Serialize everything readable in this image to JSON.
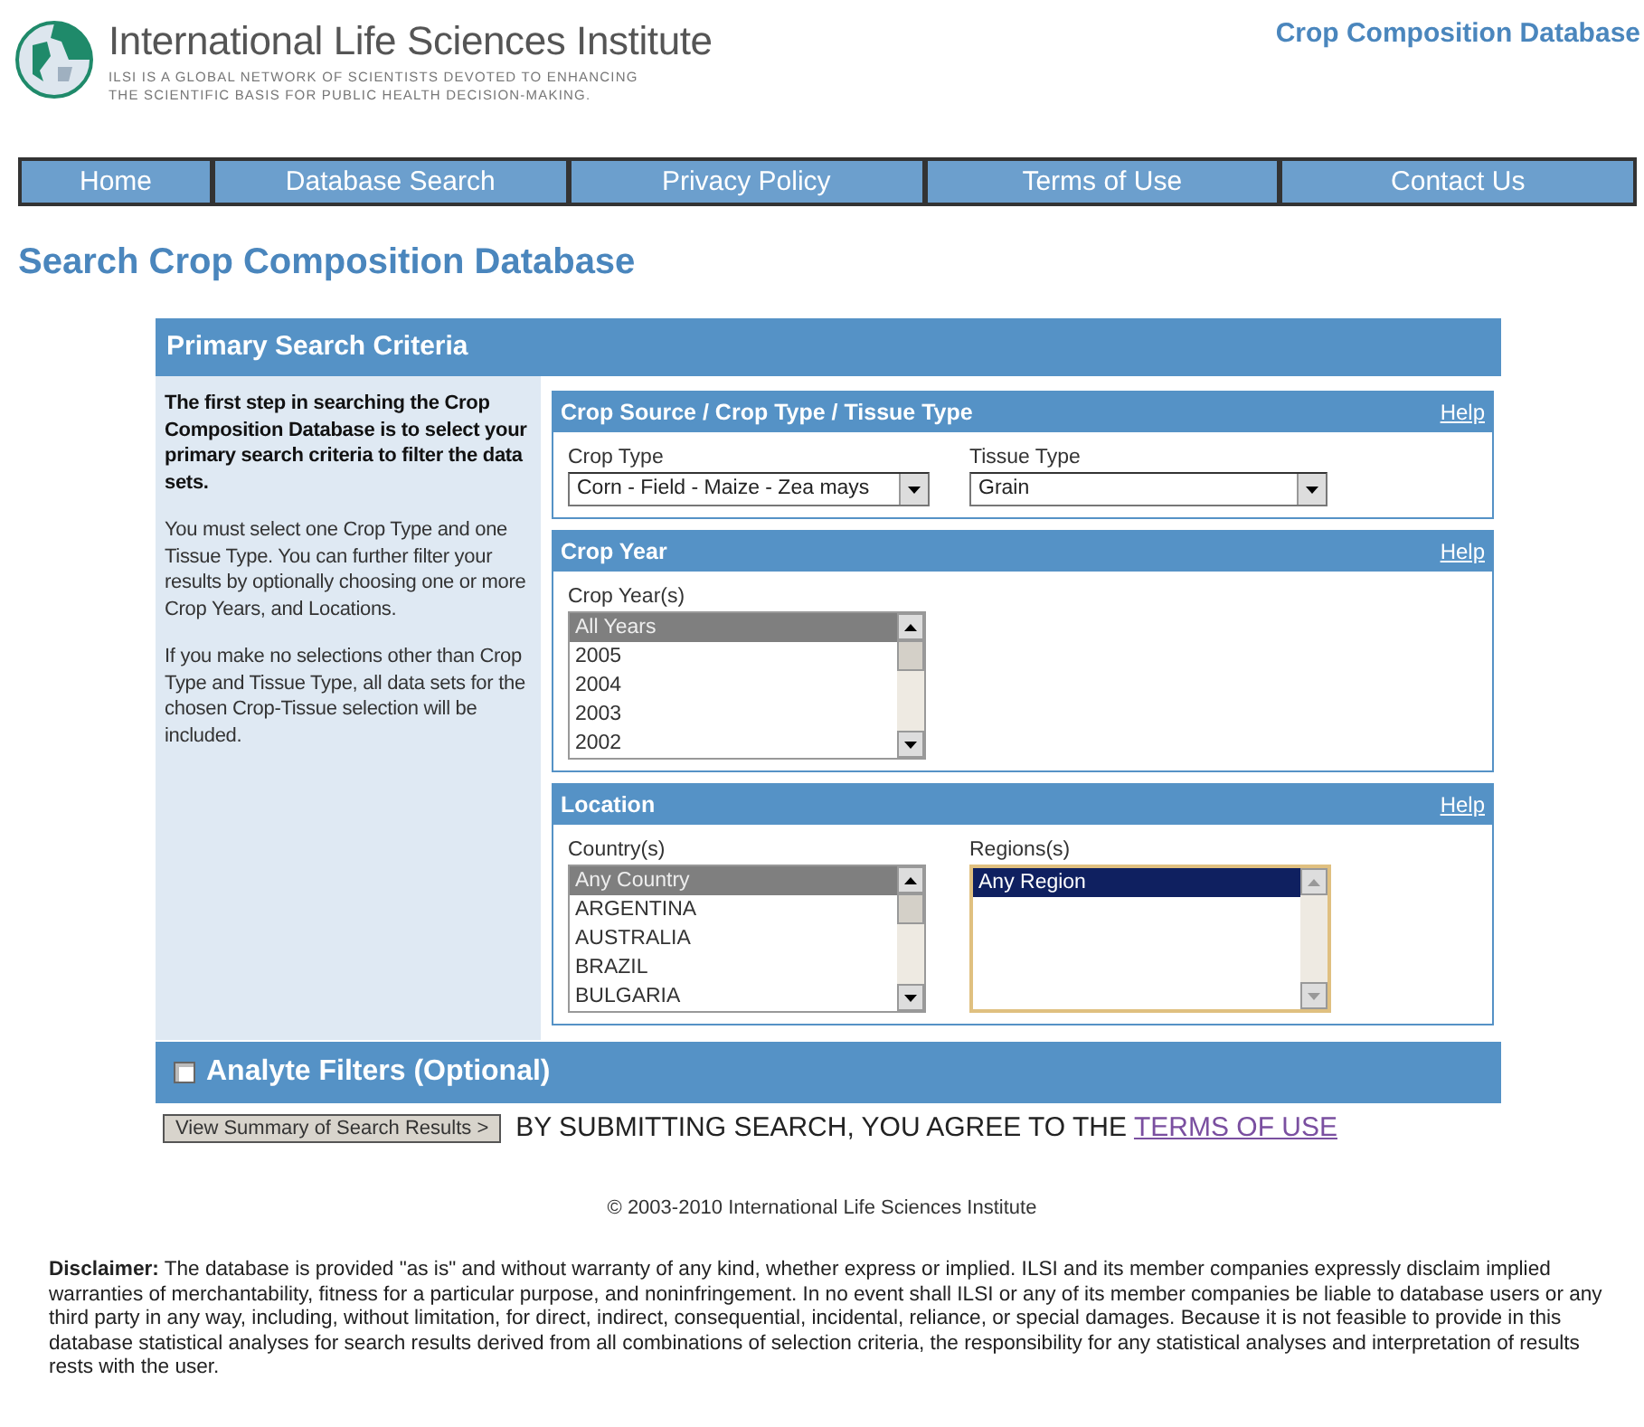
{
  "header": {
    "org_name": "International Life Sciences Institute",
    "tagline_lines": [
      "ILSI IS A GLOBAL NETWORK OF SCIENTISTS DEVOTED TO ENHANCING",
      "THE SCIENTIFIC BASIS FOR PUBLIC HEALTH DECISION-MAKING."
    ],
    "site_title": "Crop Composition Database"
  },
  "nav": [
    "Home",
    "Database Search",
    "Privacy Policy",
    "Terms of Use",
    "Contact Us"
  ],
  "page_title": "Search Crop Composition Database",
  "panel": {
    "title": "Primary Search Criteria",
    "intro": [
      {
        "kind": "lead",
        "text": "The first step in searching the Crop Composition Database is to select your primary search criteria to filter the data sets."
      },
      {
        "kind": "body",
        "text": "You must select one Crop Type and one Tissue Type. You can further filter your results by optionally choosing one or more Crop Years, and Locations."
      },
      {
        "kind": "body",
        "text": "If you make no selections other than Crop Type and Tissue Type, all data sets for the chosen Crop-Tissue selection will be included."
      }
    ],
    "sections": [
      {
        "title": "Crop Source / Crop Type / Tissue Type",
        "help": "Help",
        "fields": [
          {
            "kind": "select",
            "label": "Crop Type",
            "value": "Corn - Field - Maize - Zea mays"
          },
          {
            "kind": "select",
            "label": "Tissue Type",
            "value": "Grain"
          }
        ]
      },
      {
        "title": "Crop Year",
        "help": "Help",
        "fields": [
          {
            "kind": "list",
            "label": "Crop Year(s)",
            "focused": false,
            "items": [
              {
                "text": "All Years",
                "selected": true
              },
              {
                "text": "2005",
                "selected": false
              },
              {
                "text": "2004",
                "selected": false
              },
              {
                "text": "2003",
                "selected": false
              },
              {
                "text": "2002",
                "selected": false
              }
            ]
          }
        ]
      },
      {
        "title": "Location",
        "help": "Help",
        "fields": [
          {
            "kind": "list",
            "label": "Country(s)",
            "focused": false,
            "items": [
              {
                "text": "Any Country",
                "selected": true
              },
              {
                "text": "ARGENTINA",
                "selected": false
              },
              {
                "text": "AUSTRALIA",
                "selected": false
              },
              {
                "text": "BRAZIL",
                "selected": false
              },
              {
                "text": "BULGARIA",
                "selected": false
              }
            ]
          },
          {
            "kind": "list",
            "label": "Regions(s)",
            "focused": true,
            "items": [
              {
                "text": "Any Region",
                "selected": true
              }
            ]
          }
        ]
      }
    ],
    "analyte": {
      "label": "Analyte Filters (Optional)",
      "checked": false
    }
  },
  "submit": {
    "button": "View Summary of Search Results >",
    "notice": "BY SUBMITTING SEARCH, YOU AGREE TO THE",
    "link": "TERMS OF USE"
  },
  "copyright": "© 2003-2010 International Life Sciences Institute",
  "disclaimer": "**Disclaimer:** The database is provided \"as is\" and without warranty of any kind, whether express or implied. ILSI and its member companies expressly disclaim implied warranties of merchantability, fitness for a particular purpose, and noninfringement. In no event shall ILSI or any of its member companies be liable to database users or any third party in any way, including, without limitation, for direct, indirect, consequential, incidental, reliance, or special damages. Because it is not feasible to provide in this database statistical analyses for search results derived from all combinations of selection criteria, the responsibility for any statistical analyses and interpretation of results rests with the user."
}
